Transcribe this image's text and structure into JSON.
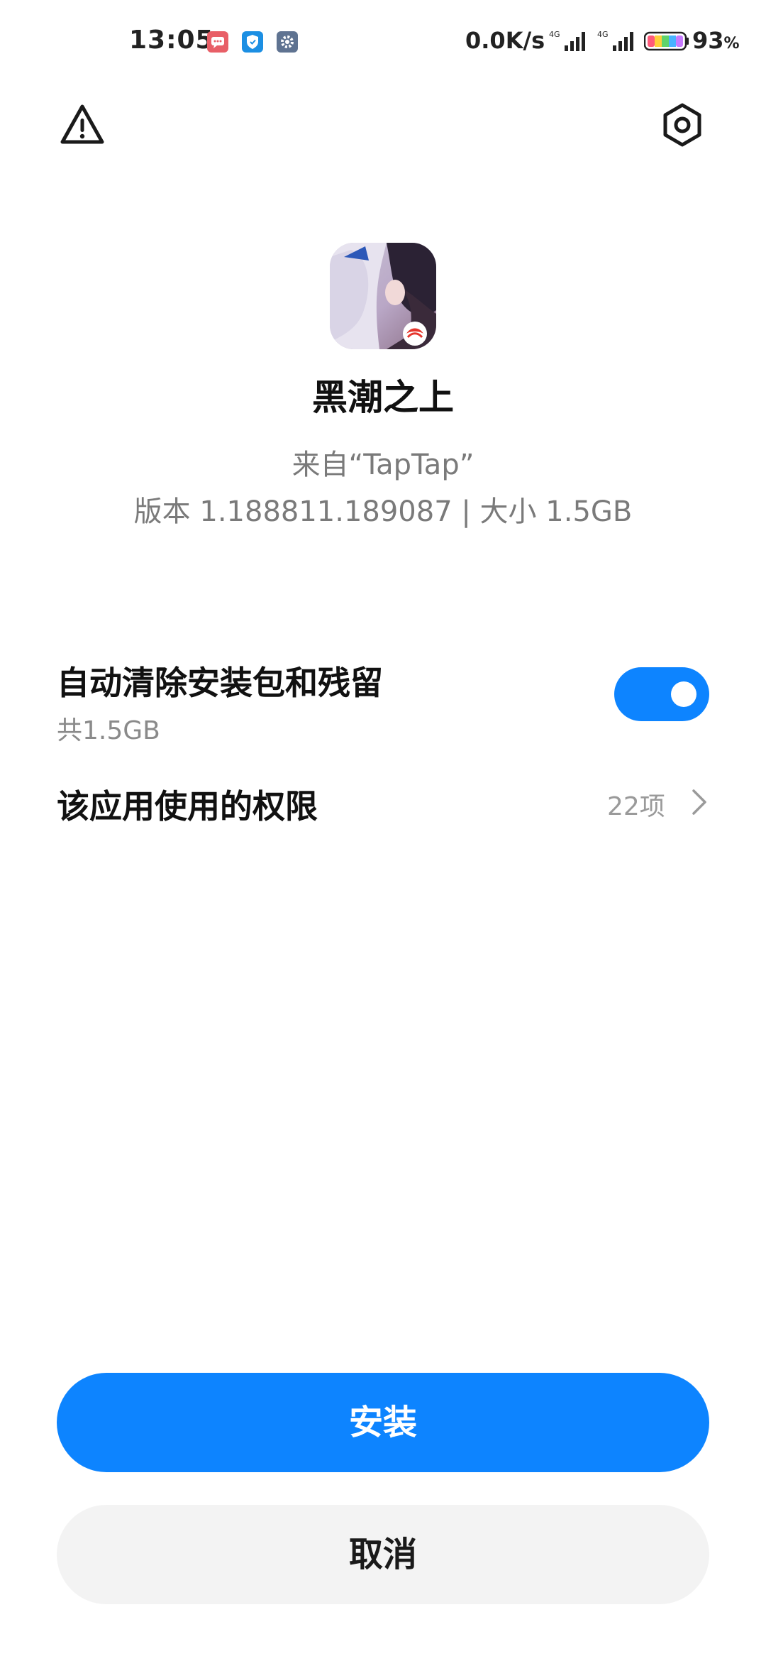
{
  "status_bar": {
    "time": "13:05",
    "net_speed": "0.0K/s",
    "signal_1_label": "4G",
    "signal_2_label": "4G",
    "battery_percent": "93",
    "battery_unit": "%",
    "notification_icons": [
      "message-icon",
      "shield-icon",
      "gear-icon"
    ]
  },
  "header": {
    "left_icon": "warning-icon",
    "right_icon": "settings-icon"
  },
  "app": {
    "name": "黑潮之上",
    "source": "来自“TapTap”",
    "meta": "版本 1.188811.189087 | 大小 1.5GB"
  },
  "options": {
    "auto_clean": {
      "title": "自动清除安装包和残留",
      "subtitle": "共1.5GB",
      "enabled": true
    },
    "permissions": {
      "title": "该应用使用的权限",
      "count": "22项"
    }
  },
  "buttons": {
    "install": "安装",
    "cancel": "取消"
  },
  "colors": {
    "accent": "#0d84ff",
    "cancel_bg": "#f3f3f3",
    "secondary_text": "#7a7a7a"
  }
}
